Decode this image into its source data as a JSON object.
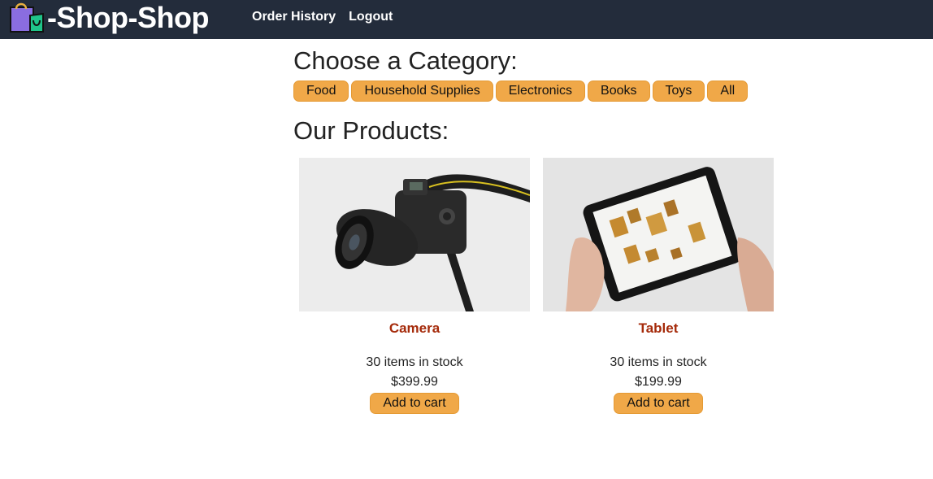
{
  "nav": {
    "brand": "-Shop-Shop",
    "logo_icon": "shopping-bag-icon",
    "links": [
      "Order History",
      "Logout"
    ]
  },
  "categories": {
    "heading": "Choose a Category:",
    "items": [
      "Food",
      "Household Supplies",
      "Electronics",
      "Books",
      "Toys",
      "All"
    ]
  },
  "products": {
    "heading": "Our Products:",
    "items": [
      {
        "name": "Camera",
        "image": "camera-photo",
        "stock": "30 items in stock",
        "price": "$399.99",
        "button": "Add to cart"
      },
      {
        "name": "Tablet",
        "image": "tablet-photo",
        "stock": "30 items in stock",
        "price": "$199.99",
        "button": "Add to cart"
      }
    ]
  },
  "colors": {
    "navbar": "#232c3b",
    "button": "#f0a848",
    "product_name": "#a52a0a"
  }
}
